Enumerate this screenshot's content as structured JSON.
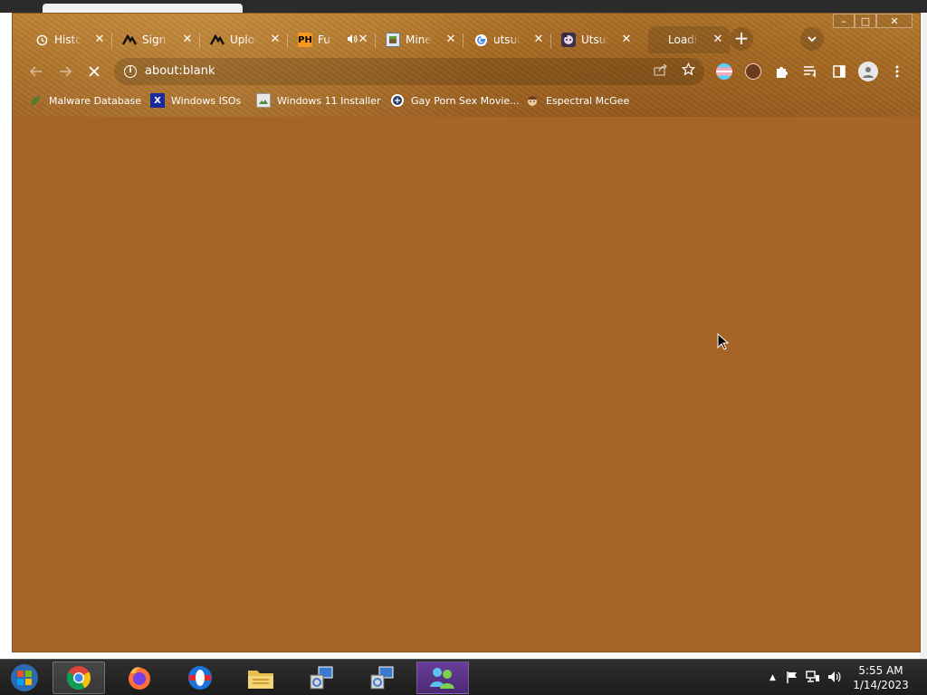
{
  "browser": {
    "tabs": [
      {
        "title": "History",
        "favicon": "clock-icon"
      },
      {
        "title": "Sign up",
        "favicon": "gitbook-icon"
      },
      {
        "title": "Upload",
        "favicon": "gitbook-icon"
      },
      {
        "title": "Fu",
        "favicon": "ph-icon",
        "favicon_text": "PH",
        "audio": true
      },
      {
        "title": "Minecraft",
        "favicon": "minecraft-icon"
      },
      {
        "title": "utsuro",
        "favicon": "google-icon"
      },
      {
        "title": "Utsuro",
        "favicon": "anime-icon"
      },
      {
        "title": "Loading",
        "favicon": ""
      }
    ],
    "window_controls": {
      "minimize": "–",
      "maximize": "□",
      "close": "✕"
    },
    "omnibox": {
      "url": "about:blank"
    },
    "bookmarks": [
      {
        "label": "Malware Database",
        "icon": "leaf-icon"
      },
      {
        "label": "Windows ISOs",
        "icon": "x-icon",
        "icon_text": "X"
      },
      {
        "label": "Windows 11 Installer",
        "icon": "image-icon"
      },
      {
        "label": "Gay Porn Sex Movie...",
        "icon": "badge-icon"
      },
      {
        "label": "Espectral McGee",
        "icon": "face-icon"
      }
    ],
    "colors": {
      "theme": "#a66526",
      "frame": "#a86a22"
    }
  },
  "taskbar": {
    "apps": [
      {
        "name": "start-orb"
      },
      {
        "name": "chrome"
      },
      {
        "name": "firefox"
      },
      {
        "name": "opera"
      },
      {
        "name": "file-explorer"
      },
      {
        "name": "setup"
      },
      {
        "name": "setup-2"
      },
      {
        "name": "windows-live-messenger"
      }
    ],
    "clock": {
      "time": "5:55 AM",
      "date": "1/14/2023"
    }
  }
}
